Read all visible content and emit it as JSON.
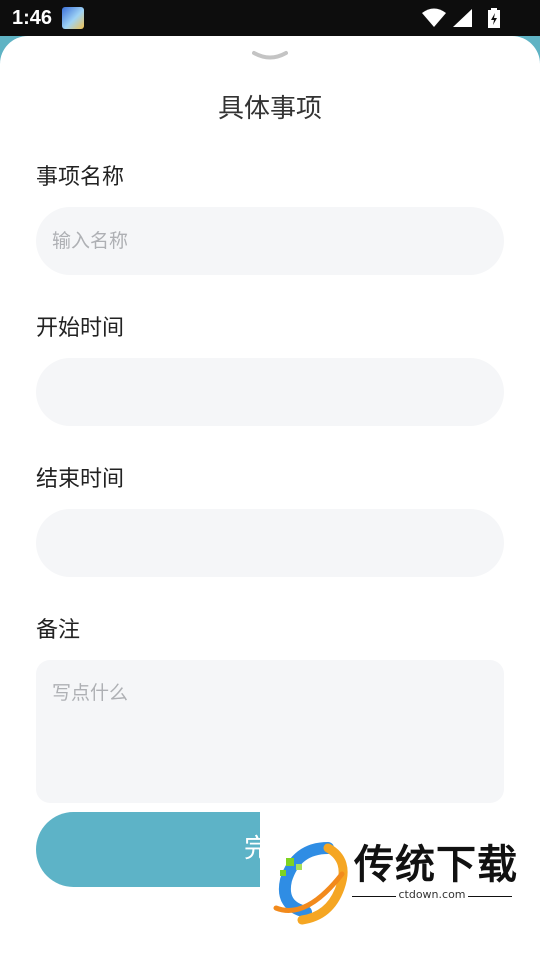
{
  "status_bar": {
    "time": "1:46",
    "icons": [
      "app-notification-icon",
      "wifi-icon",
      "signal-icon",
      "battery-charging-icon"
    ]
  },
  "sheet": {
    "title": "具体事项",
    "handle_icon": "chevron-down-icon"
  },
  "fields": {
    "name": {
      "label": "事项名称",
      "placeholder": "输入名称",
      "value": ""
    },
    "start": {
      "label": "开始时间",
      "value": ""
    },
    "end": {
      "label": "结束时间",
      "value": ""
    },
    "note": {
      "label": "备注",
      "placeholder": "写点什么",
      "value": ""
    }
  },
  "done_button": {
    "label": "完成"
  },
  "watermark": {
    "text": "传统下载",
    "url": "ctdown.com"
  },
  "colors": {
    "backdrop": "#5fb3c4",
    "accent": "#5db3c7",
    "field_bg": "#f5f6f8",
    "placeholder": "#aeb0b4"
  }
}
